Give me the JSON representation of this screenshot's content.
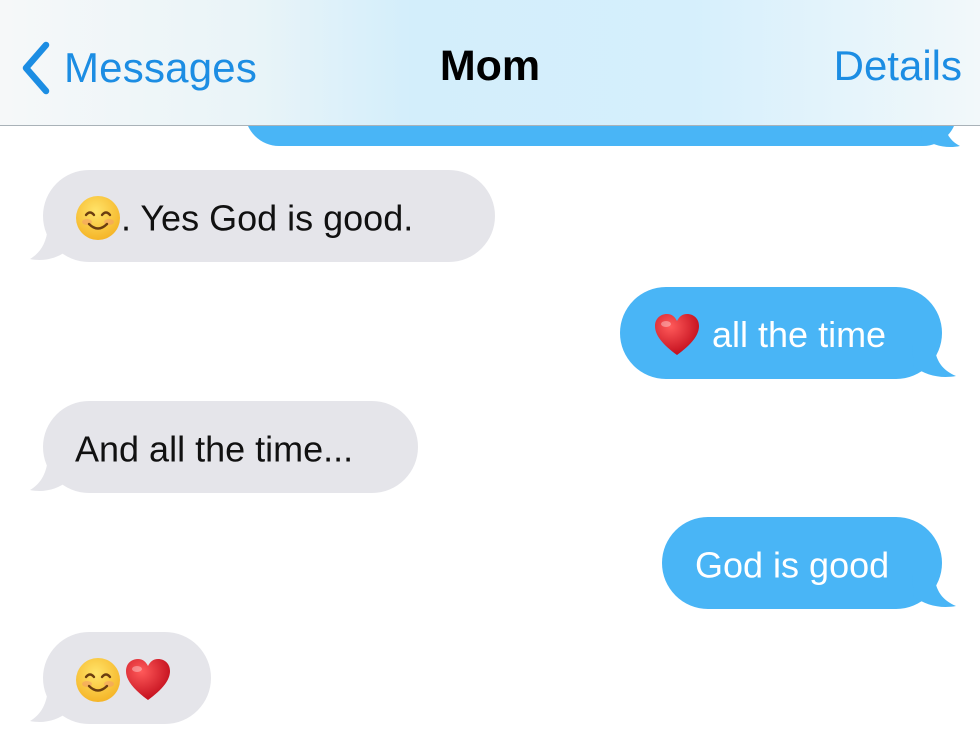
{
  "navbar": {
    "back_label": "Messages",
    "title": "Mom",
    "details_label": "Details"
  },
  "colors": {
    "ios_blue": "#1c8de3",
    "outgoing_bubble": "#49b5f6",
    "incoming_bubble": "#e5e5ea"
  },
  "messages": [
    {
      "direction": "outgoing",
      "text": "",
      "emoji": [],
      "partially_hidden": true
    },
    {
      "direction": "incoming",
      "text": ". Yes God is good.",
      "emoji": [
        "smiling-face"
      ]
    },
    {
      "direction": "outgoing",
      "text": "all the time",
      "emoji": [
        "red-heart"
      ]
    },
    {
      "direction": "incoming",
      "text": "And all the time...",
      "emoji": []
    },
    {
      "direction": "outgoing",
      "text": "God is good",
      "emoji": []
    },
    {
      "direction": "incoming",
      "text": "",
      "emoji": [
        "smiling-face",
        "red-heart"
      ]
    }
  ]
}
